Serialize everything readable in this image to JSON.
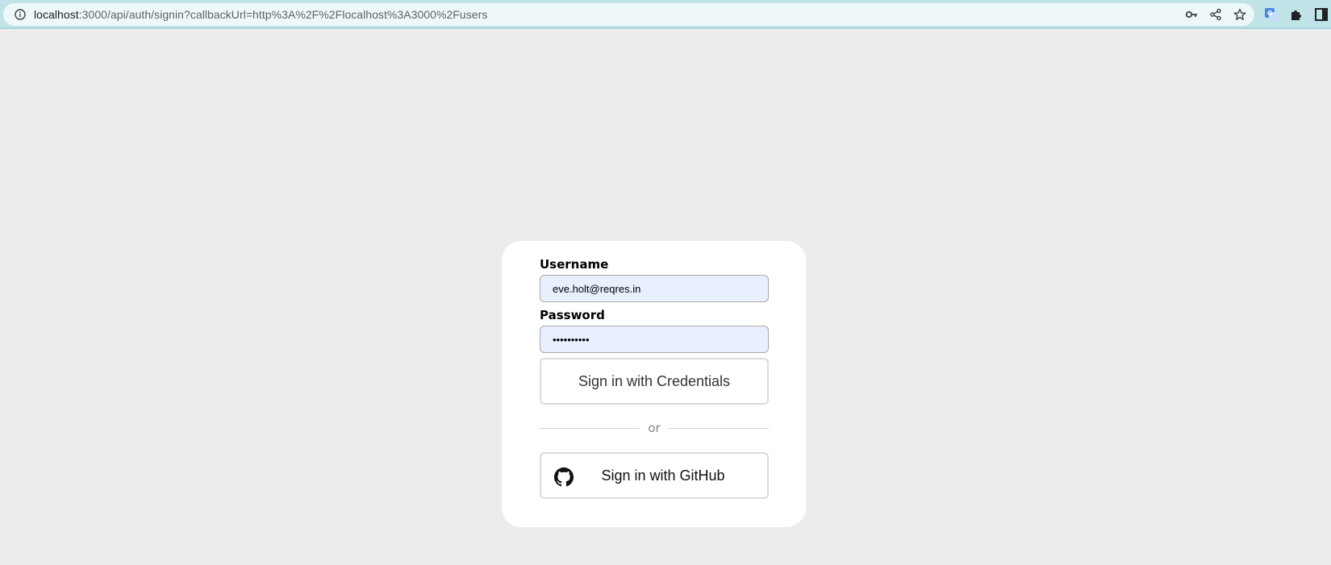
{
  "browser": {
    "url_host": "localhost",
    "url_rest": ":3000/api/auth/signin?callbackUrl=http%3A%2F%2Flocalhost%3A3000%2Fusers",
    "icons": [
      "info-icon",
      "key-icon",
      "share-icon",
      "star-icon",
      "translate-icon",
      "extensions-icon",
      "side-panel-icon"
    ]
  },
  "signin": {
    "username_label": "Username",
    "username_value": "eve.holt@reqres.in",
    "password_label": "Password",
    "password_value": "••••••••••",
    "credentials_button": "Sign in with Credentials",
    "divider_text": "or",
    "github_button": "Sign in with GitHub",
    "github_icon": "github-icon"
  },
  "colors": {
    "page_bg": "#ececec",
    "card_bg": "#ffffff",
    "input_bg": "#e8f0fe",
    "browser_bar": "#bfe3e6"
  }
}
